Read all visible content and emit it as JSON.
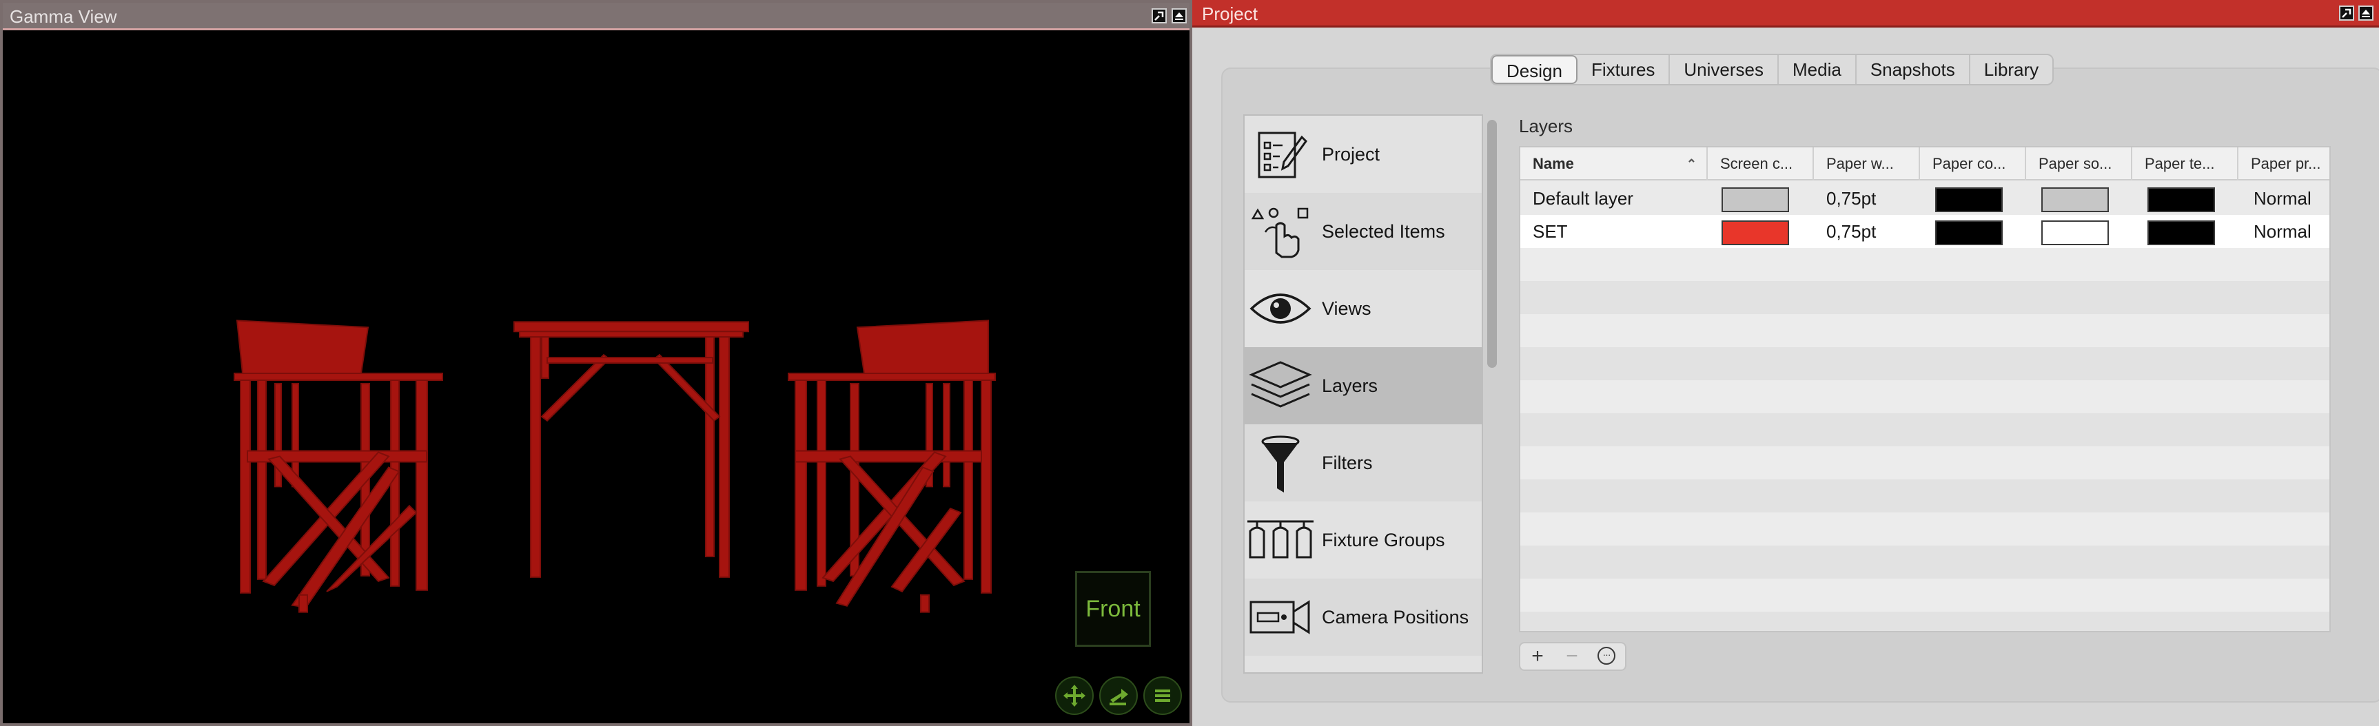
{
  "gamma_view": {
    "title": "Gamma View",
    "badge": "Front",
    "colors": {
      "furniture": "#a6140f",
      "badge_text": "#7cba3c"
    },
    "controls": [
      {
        "name": "move-icon"
      },
      {
        "name": "orbit-icon"
      },
      {
        "name": "menu-icon"
      }
    ]
  },
  "project": {
    "title": "Project",
    "accent": "#c2302a",
    "tabs": [
      "Design",
      "Fixtures",
      "Universes",
      "Media",
      "Snapshots",
      "Library"
    ],
    "active_tab": "Design",
    "sidebar": [
      {
        "label": "Project",
        "icon": "checklist-icon"
      },
      {
        "label": "Selected Items",
        "icon": "pointer-shapes-icon"
      },
      {
        "label": "Views",
        "icon": "eye-icon"
      },
      {
        "label": "Layers",
        "icon": "layers-icon"
      },
      {
        "label": "Filters",
        "icon": "funnel-icon"
      },
      {
        "label": "Fixture Groups",
        "icon": "fixture-group-icon"
      },
      {
        "label": "Camera Positions",
        "icon": "camera-icon"
      }
    ],
    "selected_sidebar": "Layers",
    "layers": {
      "title": "Layers",
      "columns": [
        "Name",
        "Screen c...",
        "Paper w...",
        "Paper co...",
        "Paper so...",
        "Paper te...",
        "Paper pr..."
      ],
      "rows": [
        {
          "name": "Default layer",
          "screen_color": "#c6c6c6",
          "paper_width": "0,75pt",
          "paper_color": "#000000",
          "paper_solid": "#c6c6c6",
          "paper_text": "#000000",
          "paper_print": "Normal"
        },
        {
          "name": "SET",
          "screen_color": "#e8362a",
          "paper_width": "0,75pt",
          "paper_color": "#000000",
          "paper_solid": "#ffffff",
          "paper_text": "#000000",
          "paper_print": "Normal"
        }
      ],
      "buttons": {
        "add": "+",
        "remove": "−",
        "more": "···"
      }
    }
  }
}
